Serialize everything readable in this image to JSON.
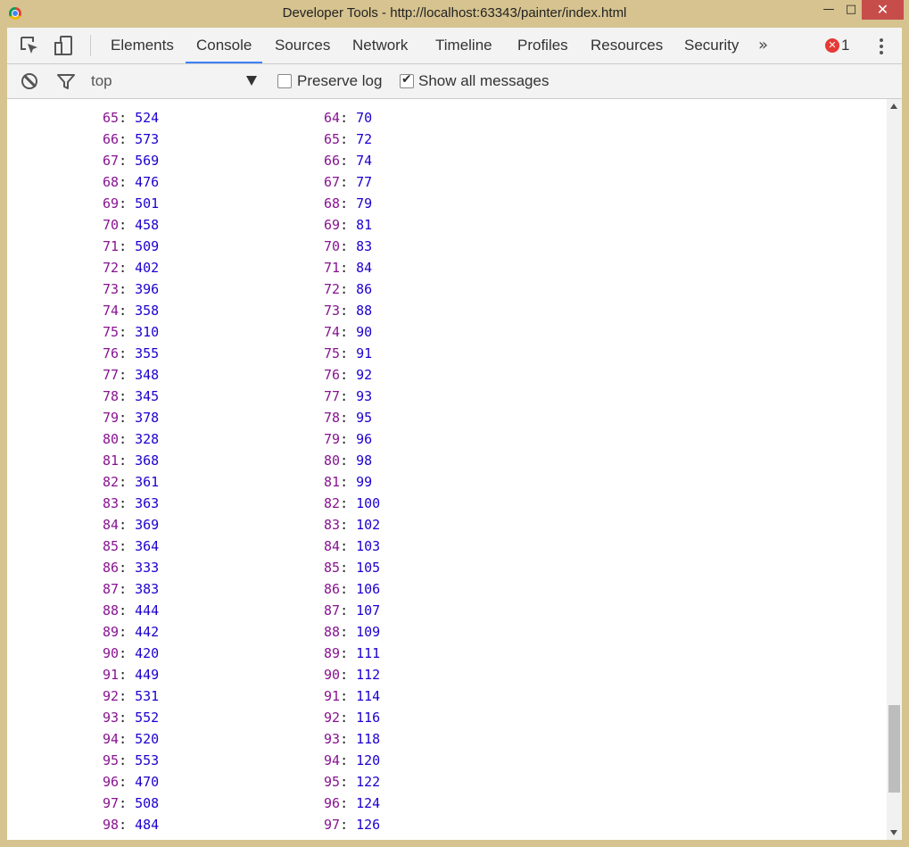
{
  "window": {
    "title": "Developer Tools - http://localhost:63343/painter/index.html",
    "minimize_glyph": "—",
    "maximize_glyph": "□",
    "close_glyph": "✕"
  },
  "tabs": [
    "Elements",
    "Console",
    "Sources",
    "Network",
    "Timeline",
    "Profiles",
    "Resources",
    "Security"
  ],
  "active_tab": "Console",
  "more_tabs_glyph": "»",
  "errors": {
    "badge": "✕",
    "count": "1"
  },
  "toolbar": {
    "context": "top",
    "preserve_log": {
      "label": "Preserve log",
      "checked": false
    },
    "show_all": {
      "label": "Show all messages",
      "checked": true
    }
  },
  "console": {
    "left_column": [
      {
        "k": "65",
        "v": "524"
      },
      {
        "k": "66",
        "v": "573"
      },
      {
        "k": "67",
        "v": "569"
      },
      {
        "k": "68",
        "v": "476"
      },
      {
        "k": "69",
        "v": "501"
      },
      {
        "k": "70",
        "v": "458"
      },
      {
        "k": "71",
        "v": "509"
      },
      {
        "k": "72",
        "v": "402"
      },
      {
        "k": "73",
        "v": "396"
      },
      {
        "k": "74",
        "v": "358"
      },
      {
        "k": "75",
        "v": "310"
      },
      {
        "k": "76",
        "v": "355"
      },
      {
        "k": "77",
        "v": "348"
      },
      {
        "k": "78",
        "v": "345"
      },
      {
        "k": "79",
        "v": "378"
      },
      {
        "k": "80",
        "v": "328"
      },
      {
        "k": "81",
        "v": "368"
      },
      {
        "k": "82",
        "v": "361"
      },
      {
        "k": "83",
        "v": "363"
      },
      {
        "k": "84",
        "v": "369"
      },
      {
        "k": "85",
        "v": "364"
      },
      {
        "k": "86",
        "v": "333"
      },
      {
        "k": "87",
        "v": "383"
      },
      {
        "k": "88",
        "v": "444"
      },
      {
        "k": "89",
        "v": "442"
      },
      {
        "k": "90",
        "v": "420"
      },
      {
        "k": "91",
        "v": "449"
      },
      {
        "k": "92",
        "v": "531"
      },
      {
        "k": "93",
        "v": "552"
      },
      {
        "k": "94",
        "v": "520"
      },
      {
        "k": "95",
        "v": "553"
      },
      {
        "k": "96",
        "v": "470"
      },
      {
        "k": "97",
        "v": "508"
      },
      {
        "k": "98",
        "v": "484"
      }
    ],
    "right_column": [
      {
        "k": "64",
        "v": "70"
      },
      {
        "k": "65",
        "v": "72"
      },
      {
        "k": "66",
        "v": "74"
      },
      {
        "k": "67",
        "v": "77"
      },
      {
        "k": "68",
        "v": "79"
      },
      {
        "k": "69",
        "v": "81"
      },
      {
        "k": "70",
        "v": "83"
      },
      {
        "k": "71",
        "v": "84"
      },
      {
        "k": "72",
        "v": "86"
      },
      {
        "k": "73",
        "v": "88"
      },
      {
        "k": "74",
        "v": "90"
      },
      {
        "k": "75",
        "v": "91"
      },
      {
        "k": "76",
        "v": "92"
      },
      {
        "k": "77",
        "v": "93"
      },
      {
        "k": "78",
        "v": "95"
      },
      {
        "k": "79",
        "v": "96"
      },
      {
        "k": "80",
        "v": "98"
      },
      {
        "k": "81",
        "v": "99"
      },
      {
        "k": "82",
        "v": "100"
      },
      {
        "k": "83",
        "v": "102"
      },
      {
        "k": "84",
        "v": "103"
      },
      {
        "k": "85",
        "v": "105"
      },
      {
        "k": "86",
        "v": "106"
      },
      {
        "k": "87",
        "v": "107"
      },
      {
        "k": "88",
        "v": "109"
      },
      {
        "k": "89",
        "v": "111"
      },
      {
        "k": "90",
        "v": "112"
      },
      {
        "k": "91",
        "v": "114"
      },
      {
        "k": "92",
        "v": "116"
      },
      {
        "k": "93",
        "v": "118"
      },
      {
        "k": "94",
        "v": "120"
      },
      {
        "k": "95",
        "v": "122"
      },
      {
        "k": "96",
        "v": "124"
      },
      {
        "k": "97",
        "v": "126"
      }
    ]
  },
  "colors": {
    "key": "#881391",
    "value": "#1c00cf",
    "active_tab_underline": "#3e82f7",
    "error_badge": "#e53935",
    "title_bar": "#d6c38f",
    "close_button": "#c74d4b"
  }
}
